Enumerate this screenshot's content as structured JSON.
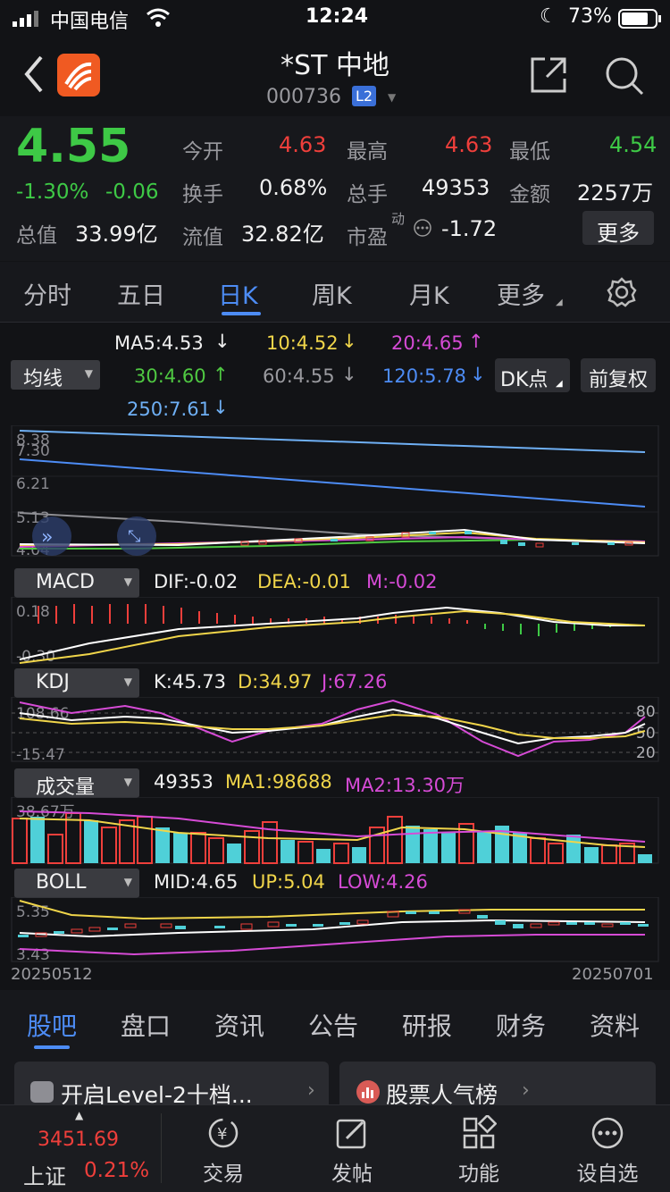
{
  "status": {
    "carrier": "中国电信",
    "time": "12:24",
    "battery": "73%"
  },
  "header": {
    "title": "*ST 中地",
    "code": "000736",
    "level_badge": "L2"
  },
  "quote": {
    "price": "4.55",
    "change_pct": "-1.30%",
    "change": "-0.06",
    "open_label": "今开",
    "open": "4.63",
    "high_label": "最高",
    "high": "4.63",
    "low_label": "最低",
    "low": "4.54",
    "turnover_label": "换手",
    "turnover": "0.68%",
    "volume_label": "总手",
    "volume": "49353",
    "amount_label": "金额",
    "amount": "2257万",
    "mktcap_label": "总值",
    "mktcap": "33.99亿",
    "float_label": "流值",
    "float": "32.82亿",
    "pe_label": "市盈",
    "pe_sup": "动",
    "pe": "-1.72",
    "more_button": "更多"
  },
  "period_tabs": [
    "分时",
    "五日",
    "日K",
    "周K",
    "月K",
    "更多"
  ],
  "ma_bar": {
    "selector": "均线",
    "ma5": "MA5:4.53",
    "ma10": "10:4.52",
    "ma20": "20:4.65",
    "ma30": "30:4.60",
    "ma60": "60:4.55",
    "ma120": "120:5.78",
    "ma250": "250:7.61",
    "dk_button": "DK点",
    "adjust_button": "前复权"
  },
  "main_axis": [
    "8.38",
    "7.30",
    "6.21",
    "5.13",
    "4.04"
  ],
  "macd": {
    "selector": "MACD",
    "dif": "DIF:-0.02",
    "dea": "DEA:-0.01",
    "m": "M:-0.02",
    "top": "0.18",
    "bottom": "-0.30"
  },
  "kdj": {
    "selector": "KDJ",
    "k": "K:45.73",
    "d": "D:34.97",
    "j": "J:67.26",
    "top": "108.66",
    "bottom": "-15.47",
    "r80": "80",
    "r50": "50",
    "r20": "20"
  },
  "vol": {
    "selector": "成交量",
    "value": "49353",
    "ma1": "MA1:98688",
    "ma2": "MA2:13.30万",
    "top": "38.67万"
  },
  "boll": {
    "selector": "BOLL",
    "mid": "MID:4.65",
    "up": "UP:5.04",
    "low": "LOW:4.26",
    "top": "5.35",
    "bottom": "3.43"
  },
  "dates": {
    "start": "20250512",
    "end": "20250701"
  },
  "bottom_tabs": [
    "股吧",
    "盘口",
    "资讯",
    "公告",
    "研报",
    "财务",
    "资料"
  ],
  "cards": {
    "level2": "开启Level-2十档...",
    "popularity": "股票人气榜"
  },
  "index": {
    "value": "3451.69",
    "name": "上证",
    "pct": "0.21%"
  },
  "footer": [
    "交易",
    "发帖",
    "功能",
    "设自选"
  ],
  "colors": {
    "up": "#ef3f3b",
    "down": "#3ec946",
    "accent": "#4d8cf5"
  }
}
